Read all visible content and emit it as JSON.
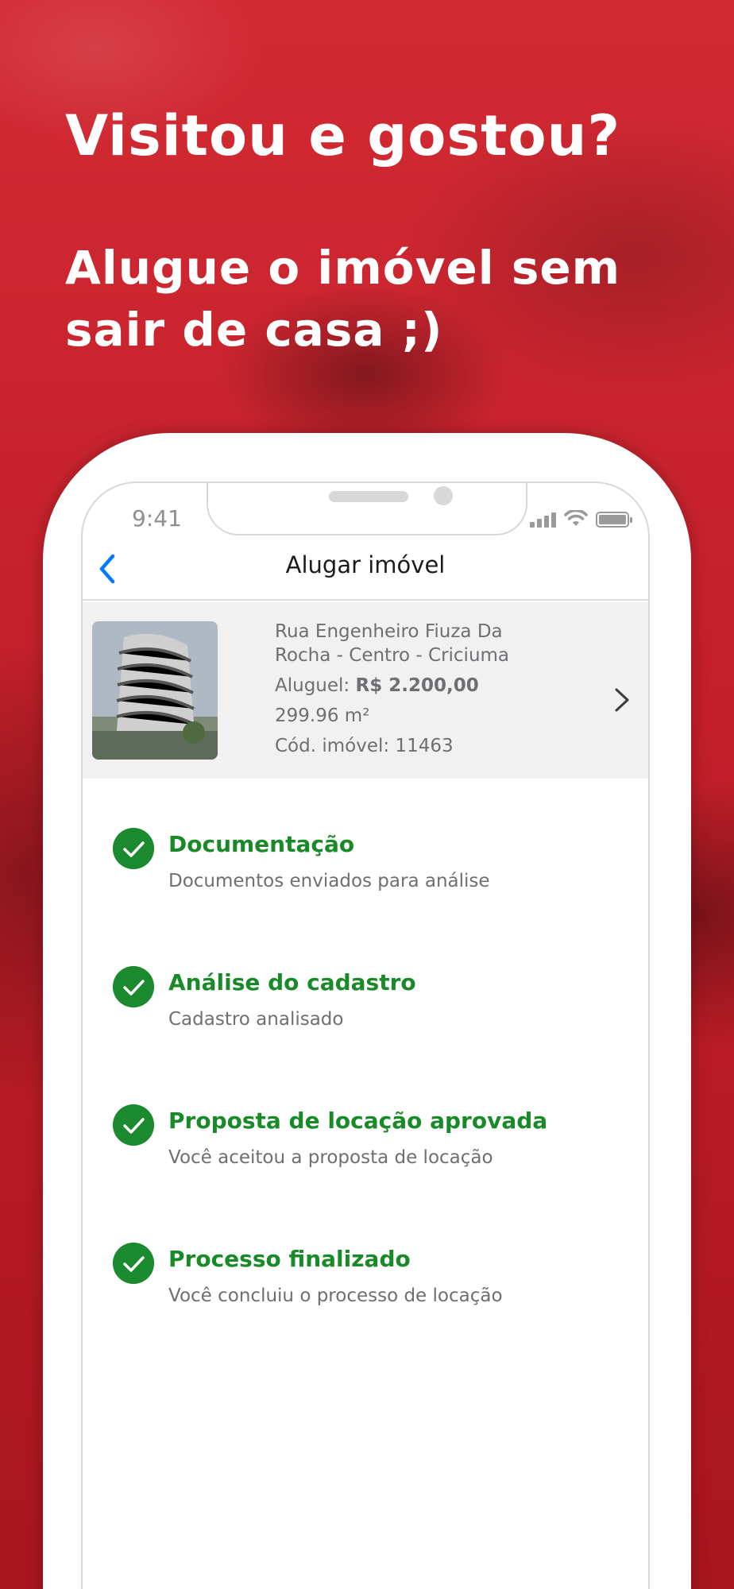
{
  "hero": {
    "headline": "Visitou e gostou?",
    "subheadline": "Alugue o imóvel sem sair de casa ;)"
  },
  "status_bar": {
    "time": "9:41"
  },
  "navbar": {
    "title": "Alugar imóvel"
  },
  "property": {
    "address": "Rua Engenheiro Fiuza Da Rocha - Centro - Criciuma",
    "rent_label": "Aluguel:",
    "rent_value": "R$ 2.200,00",
    "area": "299.96 m²",
    "code": "Cód. imóvel: 11463"
  },
  "steps": [
    {
      "title": "Documentação",
      "subtitle": "Documentos enviados para análise"
    },
    {
      "title": "Análise do cadastro",
      "subtitle": "Cadastro analisado"
    },
    {
      "title": "Proposta de locação aprovada",
      "subtitle": "Você aceitou a proposta de locação"
    },
    {
      "title": "Processo finalizado",
      "subtitle": "Você concluiu o processo de locação"
    }
  ],
  "colors": {
    "brand_red": "#c8202c",
    "success_green": "#1b8a2e",
    "ios_blue": "#007aff"
  }
}
